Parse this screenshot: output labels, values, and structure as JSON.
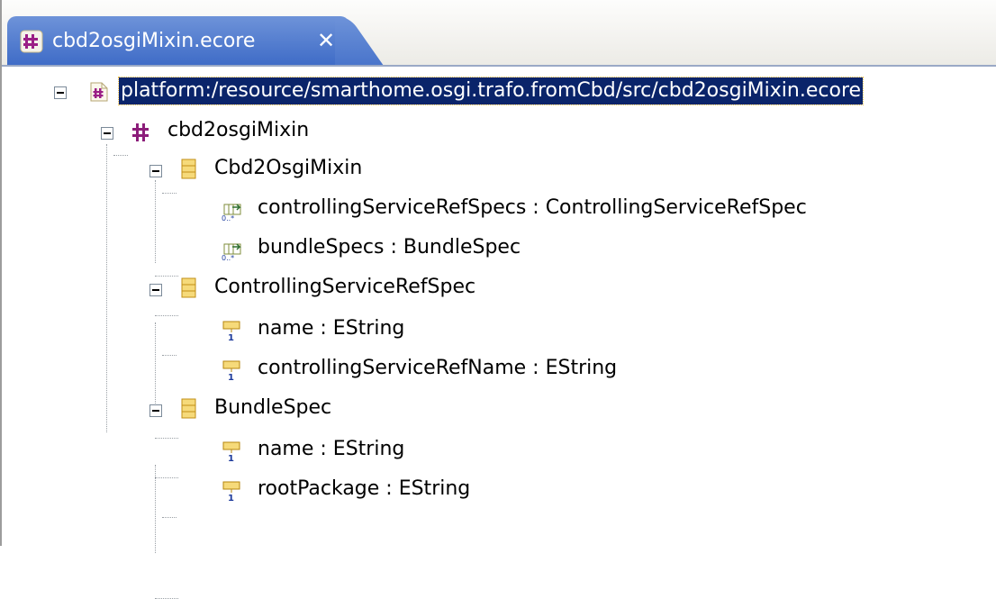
{
  "tab": {
    "title": "cbd2osgiMixin.ecore",
    "close": "✕",
    "icon": "ecore-package-icon"
  },
  "tree": {
    "resource": {
      "label": "platform:/resource/smarthome.osgi.trafo.fromCbd/src/cbd2osgiMixin.ecore",
      "icon": "ecore-resource-icon"
    },
    "package": {
      "label": "cbd2osgiMixin",
      "icon": "ecore-package-icon"
    },
    "classes": [
      {
        "label": "Cbd2OsgiMixin",
        "icon": "eclass-icon",
        "features": [
          {
            "label": "controllingServiceRefSpecs : ControllingServiceRefSpec",
            "icon": "ereference-many-icon"
          },
          {
            "label": "bundleSpecs : BundleSpec",
            "icon": "ereference-many-icon"
          }
        ]
      },
      {
        "label": "ControllingServiceRefSpec",
        "icon": "eclass-icon",
        "features": [
          {
            "label": "name : EString",
            "icon": "eattribute-icon"
          },
          {
            "label": "controllingServiceRefName : EString",
            "icon": "eattribute-icon"
          }
        ]
      },
      {
        "label": "BundleSpec",
        "icon": "eclass-icon",
        "features": [
          {
            "label": "name : EString",
            "icon": "eattribute-icon"
          },
          {
            "label": "rootPackage : EString",
            "icon": "eattribute-icon"
          }
        ]
      }
    ]
  },
  "colors": {
    "tab_active": "#4f7acd",
    "selection": "#0a246a",
    "class_icon": "#f0c85a",
    "package_icon": "#8c1d7a"
  }
}
